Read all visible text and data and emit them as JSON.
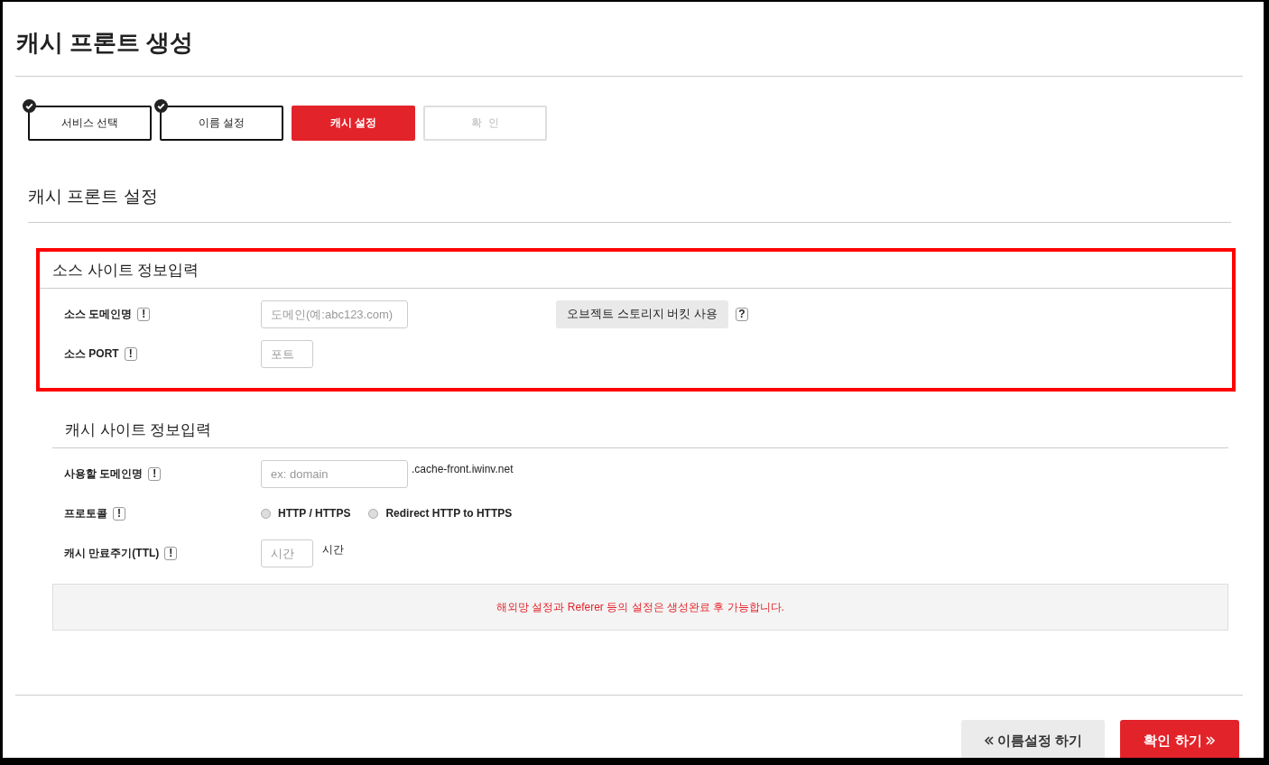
{
  "page_title": "캐시 프론트 생성",
  "steps": [
    {
      "label": "서비스 선택",
      "completed": true,
      "selected": false
    },
    {
      "label": "이름 설정",
      "completed": true,
      "selected": false
    },
    {
      "label": "캐시 설정",
      "completed": false,
      "selected": true
    },
    {
      "label": "확  인",
      "completed": false,
      "selected": false
    }
  ],
  "section_title": "캐시 프론트 설정",
  "source_section": {
    "title": "소스 사이트 정보입력",
    "domain": {
      "label": "소스 도메인명",
      "hint": "!",
      "placeholder": "도메인(예:abc123.com)"
    },
    "bucket_button": "오브젝트 스토리지 버킷 사용",
    "bucket_help": "?",
    "port": {
      "label": "소스 PORT",
      "hint": "!",
      "placeholder": "포트"
    }
  },
  "cache_section": {
    "title": "캐시 사이트 정보입력",
    "domain": {
      "label": "사용할 도메인명",
      "hint": "!",
      "placeholder": "ex: domain",
      "suffix": ".cache-front.iwinv.net"
    },
    "protocol": {
      "label": "프로토콜",
      "hint": "!",
      "options": [
        {
          "label": "HTTP / HTTPS",
          "selected": false
        },
        {
          "label": "Redirect HTTP to HTTPS",
          "selected": false
        }
      ]
    },
    "ttl": {
      "label": "캐시 만료주기(TTL)",
      "hint": "!",
      "placeholder": "시간",
      "unit": "시간"
    }
  },
  "notice": "해외망 설정과 Referer 등의 설정은 생성완료 후 가능합니다.",
  "buttons": {
    "back": "이름설정 하기",
    "next": "확인 하기"
  }
}
